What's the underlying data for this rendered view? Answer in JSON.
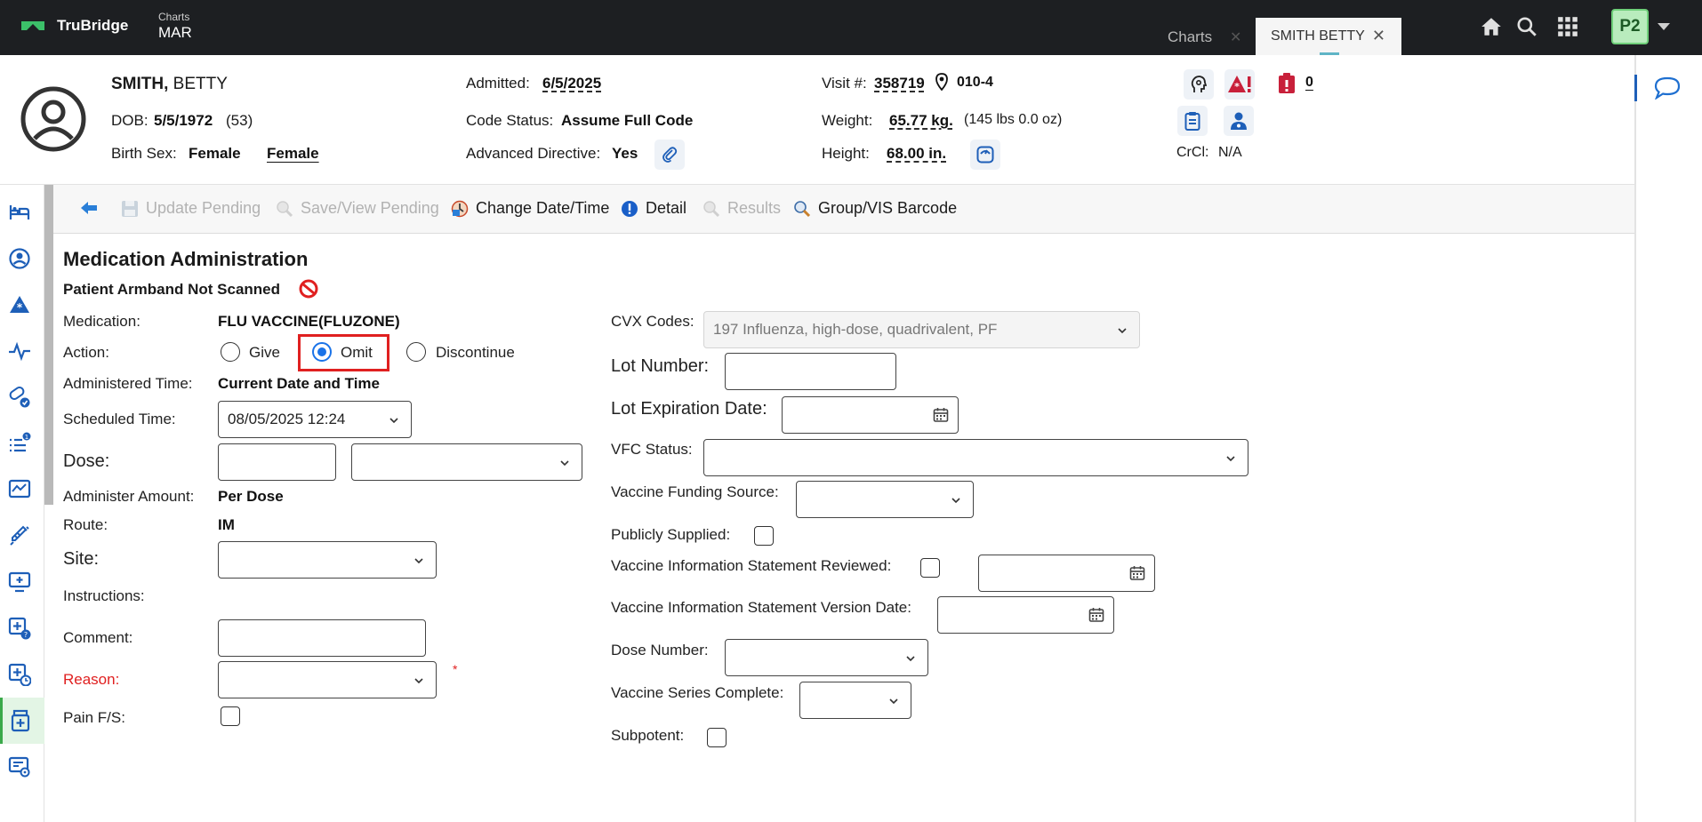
{
  "header": {
    "brand": "TruBridge",
    "app_small": "Charts",
    "app_big": "MAR",
    "tabs": [
      {
        "label": "Charts",
        "close": "✕"
      },
      {
        "label": "SMITH BETTY",
        "close": "✕"
      }
    ],
    "user_badge": "P2"
  },
  "patient": {
    "last_name": "SMITH,",
    "first_name": "BETTY",
    "dob_label": "DOB:",
    "dob": "5/5/1972",
    "age": "(53)",
    "birth_sex_label": "Birth Sex:",
    "birth_sex": "Female",
    "gender": "Female",
    "admitted_label": "Admitted:",
    "admitted": "6/5/2025",
    "code_status_label": "Code Status:",
    "code_status": "Assume Full Code",
    "adv_directive_label": "Advanced Directive:",
    "adv_directive": "Yes",
    "visit_label": "Visit #:",
    "visit": "358719",
    "room": "010-4",
    "weight_label": "Weight:",
    "weight": "65.77 kg.",
    "weight_lbs": "(145 lbs 0.0 oz)",
    "height_label": "Height:",
    "height": "68.00 in.",
    "alert_count": "0",
    "crcl_label": "CrCl:",
    "crcl": "N/A"
  },
  "toolbar": {
    "update_pending": "Update Pending",
    "save_view_pending": "Save/View Pending",
    "change_datetime": "Change Date/Time",
    "detail": "Detail",
    "results": "Results",
    "group_vis": "Group/VIS Barcode"
  },
  "form": {
    "title": "Medication Administration",
    "armband": "Patient Armband Not Scanned",
    "medication_label": "Medication:",
    "medication": "FLU VACCINE(FLUZONE)",
    "action_label": "Action:",
    "action_options": [
      "Give",
      "Omit",
      "Discontinue"
    ],
    "action_selected": "Omit",
    "administered_time_label": "Administered Time:",
    "administered_time": "Current Date and Time",
    "scheduled_time_label": "Scheduled Time:",
    "scheduled_time": "08/05/2025 12:24",
    "dose_label": "Dose:",
    "dose_value": "",
    "administer_amount_label": "Administer Amount:",
    "administer_amount": "Per Dose",
    "route_label": "Route:",
    "route": "IM",
    "site_label": "Site:",
    "instructions_label": "Instructions:",
    "comment_label": "Comment:",
    "reason_label": "Reason:",
    "required_mark": "*",
    "pain_label": "Pain F/S:",
    "cvx_label": "CVX Codes:",
    "cvx_value": "197 Influenza, high-dose, quadrivalent, PF",
    "lot_number_label": "Lot Number:",
    "lot_exp_label": "Lot Expiration Date:",
    "vfc_label": "VFC Status:",
    "funding_label": "Vaccine Funding Source:",
    "publicly_supplied_label": "Publicly Supplied:",
    "vis_reviewed_label": "Vaccine Information Statement Reviewed:",
    "vis_version_label": "Vaccine Information Statement Version Date:",
    "dose_number_label": "Dose Number:",
    "series_complete_label": "Vaccine Series Complete:",
    "subpotent_label": "Subpotent:"
  },
  "colors": {
    "topbar": "#1d1f22",
    "accent_blue": "#1a73e8",
    "required_red": "#e02020",
    "active_nav": "#3aa94a"
  }
}
